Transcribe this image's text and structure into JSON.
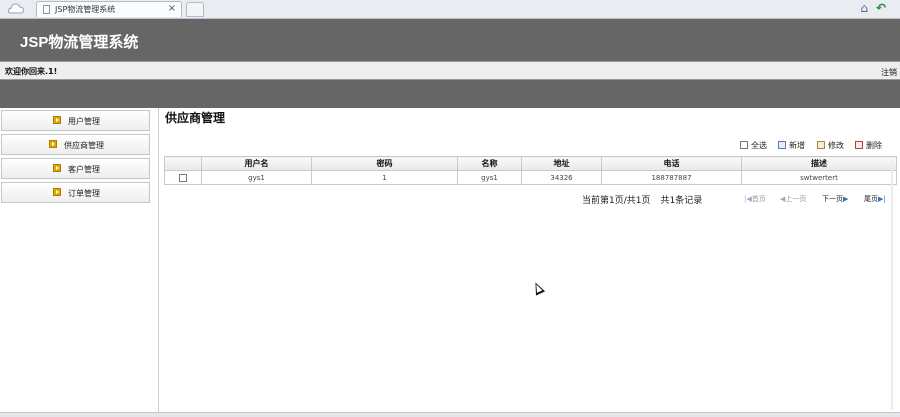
{
  "browser": {
    "tab_title": "JSP物流管理系统",
    "tab_close": "×",
    "icons": [
      "cloud-icon",
      "page-icon",
      "home-icon",
      "back-arrow-icon"
    ]
  },
  "header": {
    "app_title": "JSP物流管理系统",
    "welcome": "欢迎你回来.1!",
    "logout": "注销"
  },
  "sidebar": {
    "items": [
      {
        "label": "用户管理"
      },
      {
        "label": "供应商管理"
      },
      {
        "label": "客户管理"
      },
      {
        "label": "订单管理"
      }
    ]
  },
  "main": {
    "title": "供应商管理",
    "actions": {
      "select_all": "全选",
      "add": "新增",
      "edit": "修改",
      "delete": "删除"
    },
    "table": {
      "columns": [
        "",
        "用户名",
        "密码",
        "名称",
        "地址",
        "电话",
        "描述"
      ],
      "rows": [
        [
          "",
          "gys1",
          "1",
          "gys1",
          "34326",
          "188787887",
          "swtwertert"
        ]
      ]
    },
    "pager": {
      "page_info": "当前第1页/共1页",
      "record_info": "共1条记录",
      "first": "首页",
      "prev": "上一页",
      "next": "下一页",
      "last": "尾页"
    }
  },
  "colors": {
    "header_bg": "#666666",
    "welcome_bg": "#eeeeee",
    "sidebar_arrow": "#e2a400"
  }
}
